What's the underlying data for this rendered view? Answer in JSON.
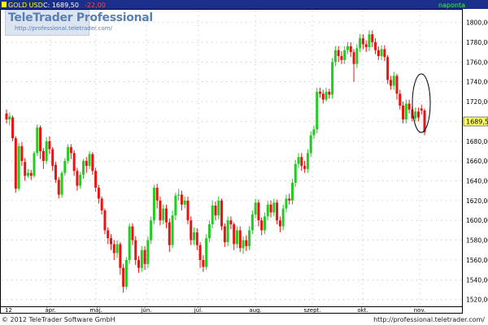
{
  "header": {
    "symbol": "GOLD USD",
    "close_label": "C: 1689,50",
    "change": "-22,00",
    "period": "napontа"
  },
  "watermark": {
    "brand": "TeleTrader Professional",
    "url": "http://professional.teletrader.com/"
  },
  "footer": {
    "copyright": "© 2012 TeleTrader Software GmbH",
    "url": "http://professional.teletrader.com/"
  },
  "colors": {
    "up": "#22cc22",
    "down": "#ee1111",
    "header_bg": "#1a2f8a",
    "price_tag": "#ffff66"
  },
  "chart_data": {
    "type": "candlestick",
    "y_ticks": [
      "1520,00",
      "1540,00",
      "1560,00",
      "1580,00",
      "1600,00",
      "1620,00",
      "1640,00",
      "1660,00",
      "1680,00",
      "1700,00",
      "1720,00",
      "1740,00",
      "1760,00",
      "1780,00",
      "1800,00"
    ],
    "ylim": [
      1514,
      1812
    ],
    "x_labels": [
      "12",
      "ápr.",
      "máj.",
      "jún.",
      "júl.",
      "aug.",
      "szept.",
      "okt.",
      "nov."
    ],
    "last_price_label": "1689,50",
    "annotation": "ellipse around latest candles",
    "candles": [
      [
        1708,
        1702,
        1712,
        1698
      ],
      [
        1702,
        1705,
        1709,
        1696
      ],
      [
        1704,
        1683,
        1706,
        1680
      ],
      [
        1683,
        1632,
        1685,
        1628
      ],
      [
        1632,
        1675,
        1678,
        1630
      ],
      [
        1675,
        1660,
        1679,
        1655
      ],
      [
        1659,
        1645,
        1663,
        1640
      ],
      [
        1645,
        1648,
        1652,
        1643
      ],
      [
        1648,
        1645,
        1651,
        1641
      ],
      [
        1645,
        1668,
        1670,
        1643
      ],
      [
        1668,
        1694,
        1697,
        1665
      ],
      [
        1694,
        1670,
        1696,
        1662
      ],
      [
        1670,
        1660,
        1673,
        1652
      ],
      [
        1660,
        1680,
        1684,
        1657
      ],
      [
        1680,
        1672,
        1685,
        1667
      ],
      [
        1672,
        1655,
        1674,
        1650
      ],
      [
        1656,
        1641,
        1659,
        1638
      ],
      [
        1641,
        1626,
        1644,
        1622
      ],
      [
        1626,
        1648,
        1650,
        1623
      ],
      [
        1648,
        1660,
        1663,
        1645
      ],
      [
        1660,
        1674,
        1677,
        1657
      ],
      [
        1674,
        1668,
        1677,
        1662
      ],
      [
        1668,
        1650,
        1671,
        1645
      ],
      [
        1650,
        1635,
        1653,
        1630
      ],
      [
        1635,
        1646,
        1649,
        1632
      ],
      [
        1646,
        1660,
        1662,
        1642
      ],
      [
        1660,
        1655,
        1664,
        1648
      ],
      [
        1655,
        1667,
        1670,
        1652
      ],
      [
        1667,
        1650,
        1669,
        1646
      ],
      [
        1650,
        1633,
        1653,
        1629
      ],
      [
        1633,
        1622,
        1636,
        1617
      ],
      [
        1622,
        1610,
        1624,
        1606
      ],
      [
        1610,
        1590,
        1612,
        1586
      ],
      [
        1590,
        1582,
        1593,
        1576
      ],
      [
        1582,
        1576,
        1586,
        1570
      ],
      [
        1576,
        1567,
        1580,
        1560
      ],
      [
        1567,
        1576,
        1580,
        1562
      ],
      [
        1576,
        1552,
        1578,
        1545
      ],
      [
        1552,
        1533,
        1556,
        1527
      ],
      [
        1533,
        1560,
        1563,
        1530
      ],
      [
        1560,
        1594,
        1597,
        1556
      ],
      [
        1594,
        1580,
        1597,
        1575
      ],
      [
        1580,
        1560,
        1584,
        1555
      ],
      [
        1560,
        1552,
        1564,
        1547
      ],
      [
        1552,
        1570,
        1574,
        1548
      ],
      [
        1570,
        1556,
        1574,
        1550
      ],
      [
        1556,
        1580,
        1584,
        1552
      ],
      [
        1580,
        1600,
        1604,
        1576
      ],
      [
        1600,
        1633,
        1636,
        1596
      ],
      [
        1633,
        1620,
        1637,
        1612
      ],
      [
        1620,
        1600,
        1624,
        1595
      ],
      [
        1600,
        1612,
        1616,
        1596
      ],
      [
        1612,
        1598,
        1616,
        1592
      ],
      [
        1598,
        1575,
        1602,
        1568
      ],
      [
        1575,
        1605,
        1610,
        1572
      ],
      [
        1605,
        1625,
        1628,
        1600
      ],
      [
        1625,
        1626,
        1632,
        1620
      ],
      [
        1626,
        1616,
        1630,
        1610
      ],
      [
        1616,
        1620,
        1624,
        1612
      ],
      [
        1620,
        1600,
        1624,
        1596
      ],
      [
        1600,
        1580,
        1604,
        1575
      ],
      [
        1580,
        1588,
        1593,
        1575
      ],
      [
        1588,
        1575,
        1592,
        1570
      ],
      [
        1575,
        1560,
        1578,
        1552
      ],
      [
        1560,
        1553,
        1565,
        1548
      ],
      [
        1553,
        1582,
        1586,
        1550
      ],
      [
        1582,
        1596,
        1600,
        1578
      ],
      [
        1596,
        1615,
        1620,
        1592
      ],
      [
        1615,
        1605,
        1619,
        1600
      ],
      [
        1605,
        1620,
        1624,
        1601
      ],
      [
        1620,
        1594,
        1622,
        1590
      ],
      [
        1594,
        1578,
        1597,
        1573
      ],
      [
        1578,
        1600,
        1604,
        1574
      ],
      [
        1600,
        1596,
        1604,
        1591
      ],
      [
        1596,
        1576,
        1598,
        1570
      ],
      [
        1576,
        1590,
        1594,
        1572
      ],
      [
        1590,
        1572,
        1594,
        1568
      ],
      [
        1572,
        1580,
        1584,
        1566
      ],
      [
        1580,
        1574,
        1585,
        1569
      ],
      [
        1574,
        1590,
        1594,
        1570
      ],
      [
        1590,
        1606,
        1610,
        1586
      ],
      [
        1606,
        1618,
        1622,
        1602
      ],
      [
        1618,
        1600,
        1621,
        1594
      ],
      [
        1600,
        1590,
        1603,
        1585
      ],
      [
        1590,
        1604,
        1608,
        1586
      ],
      [
        1604,
        1616,
        1620,
        1600
      ],
      [
        1616,
        1608,
        1620,
        1603
      ],
      [
        1608,
        1618,
        1622,
        1604
      ],
      [
        1618,
        1600,
        1621,
        1596
      ],
      [
        1600,
        1594,
        1604,
        1588
      ],
      [
        1594,
        1612,
        1616,
        1590
      ],
      [
        1612,
        1622,
        1626,
        1608
      ],
      [
        1622,
        1620,
        1627,
        1616
      ],
      [
        1620,
        1638,
        1642,
        1616
      ],
      [
        1638,
        1657,
        1661,
        1634
      ],
      [
        1657,
        1664,
        1668,
        1653
      ],
      [
        1664,
        1655,
        1668,
        1650
      ],
      [
        1655,
        1652,
        1660,
        1648
      ],
      [
        1652,
        1668,
        1672,
        1648
      ],
      [
        1668,
        1686,
        1690,
        1664
      ],
      [
        1686,
        1692,
        1696,
        1682
      ],
      [
        1692,
        1730,
        1734,
        1688
      ],
      [
        1730,
        1728,
        1734,
        1724
      ],
      [
        1728,
        1722,
        1732,
        1718
      ],
      [
        1722,
        1730,
        1734,
        1720
      ],
      [
        1730,
        1727,
        1733,
        1723
      ],
      [
        1727,
        1760,
        1764,
        1723
      ],
      [
        1760,
        1772,
        1776,
        1756
      ],
      [
        1772,
        1766,
        1776,
        1760
      ],
      [
        1766,
        1762,
        1771,
        1758
      ],
      [
        1762,
        1772,
        1776,
        1758
      ],
      [
        1772,
        1776,
        1780,
        1768
      ],
      [
        1776,
        1770,
        1780,
        1765
      ],
      [
        1770,
        1758,
        1773,
        1740
      ],
      [
        1758,
        1774,
        1778,
        1754
      ],
      [
        1774,
        1784,
        1788,
        1770
      ],
      [
        1784,
        1778,
        1788,
        1773
      ],
      [
        1778,
        1775,
        1782,
        1770
      ],
      [
        1775,
        1788,
        1792,
        1771
      ],
      [
        1788,
        1780,
        1792,
        1775
      ],
      [
        1780,
        1772,
        1784,
        1768
      ],
      [
        1772,
        1766,
        1776,
        1762
      ],
      [
        1766,
        1773,
        1777,
        1762
      ],
      [
        1773,
        1765,
        1777,
        1761
      ],
      [
        1765,
        1742,
        1767,
        1738
      ],
      [
        1742,
        1736,
        1746,
        1732
      ],
      [
        1736,
        1746,
        1750,
        1732
      ],
      [
        1746,
        1728,
        1748,
        1722
      ],
      [
        1728,
        1716,
        1732,
        1712
      ],
      [
        1716,
        1702,
        1720,
        1698
      ],
      [
        1702,
        1718,
        1722,
        1698
      ],
      [
        1718,
        1712,
        1722,
        1708
      ],
      [
        1712,
        1703,
        1715,
        1700
      ],
      [
        1703,
        1710,
        1714,
        1700
      ],
      [
        1710,
        1704,
        1714,
        1700
      ],
      [
        1713,
        1711,
        1717,
        1707
      ],
      [
        1711,
        1689,
        1713,
        1686
      ]
    ]
  }
}
